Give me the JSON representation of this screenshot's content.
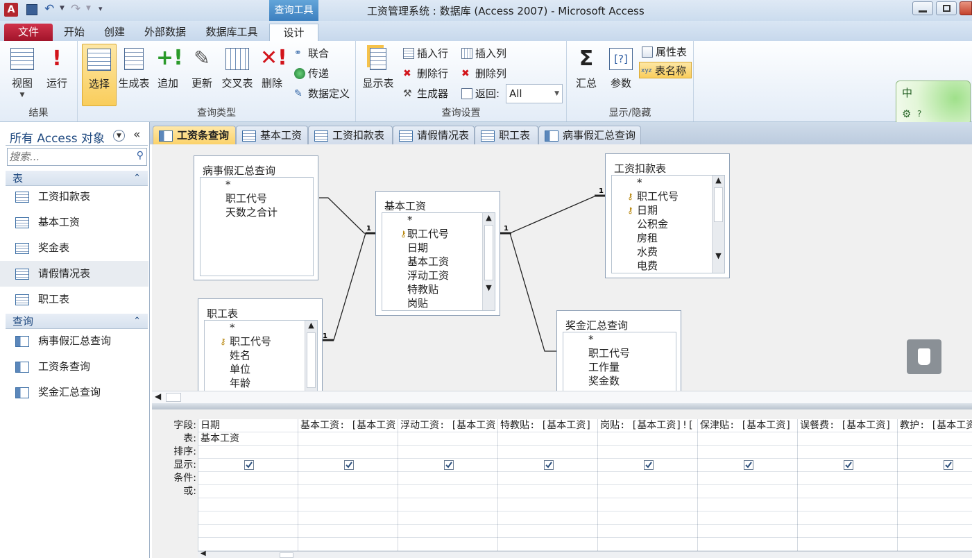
{
  "window": {
    "title": "工资管理系统 : 数据库 (Access 2007) - Microsoft Access",
    "context_tab": "查询工具"
  },
  "ribbon_tabs": [
    "文件",
    "开始",
    "创建",
    "外部数据",
    "数据库工具",
    "设计"
  ],
  "ribbon": {
    "results": {
      "label": "结果",
      "view": "视图",
      "run": "运行"
    },
    "query_type": {
      "label": "查询类型",
      "select": "选择",
      "make_table": "生成表",
      "append": "追加",
      "update": "更新",
      "crosstab": "交叉表",
      "delete": "删除",
      "union": "联合",
      "passthrough": "传递",
      "data_def": "数据定义"
    },
    "query_setup": {
      "label": "查询设置",
      "show_table": "显示表",
      "insert_row": "插入行",
      "delete_row": "删除行",
      "builder": "生成器",
      "insert_col": "插入列",
      "delete_col": "删除列",
      "return_label": "返回:",
      "return_value": "All"
    },
    "show_hide": {
      "label": "显示/隐藏",
      "totals": "汇总",
      "params": "参数",
      "property_sheet": "属性表",
      "table_names": "表名称"
    }
  },
  "lang_badge": "中",
  "nav": {
    "title": "所有 Access 对象",
    "search_placeholder": "搜索...",
    "tables_header": "表",
    "tables": [
      "工资扣款表",
      "基本工资",
      "奖金表",
      "请假情况表",
      "职工表"
    ],
    "queries_header": "查询",
    "queries": [
      "病事假汇总查询",
      "工资条查询",
      "奖金汇总查询"
    ]
  },
  "doc_tabs": [
    "工资条查询",
    "基本工资",
    "工资扣款表",
    "请假情况表",
    "职工表",
    "病事假汇总查询"
  ],
  "field_lists": [
    {
      "title": "病事假汇总查询",
      "fields": [
        "*",
        "职工代号",
        "天数之合计"
      ]
    },
    {
      "title": "基本工资",
      "fields": [
        "*",
        "职工代号",
        "日期",
        "基本工资",
        "浮动工资",
        "特教贴",
        "岗贴"
      ]
    },
    {
      "title": "工资扣款表",
      "fields": [
        "*",
        "职工代号",
        "日期",
        "公积金",
        "房租",
        "水费",
        "电费"
      ]
    },
    {
      "title": "职工表",
      "fields": [
        "*",
        "职工代号",
        "姓名",
        "单位",
        "年龄"
      ]
    },
    {
      "title": "奖金汇总查询",
      "fields": [
        "*",
        "职工代号",
        "工作量",
        "奖金数"
      ]
    }
  ],
  "join_marker": "1",
  "qbe": {
    "row_labels": [
      "字段:",
      "表:",
      "排序:",
      "显示:",
      "条件:",
      "或:"
    ],
    "columns": [
      {
        "field": "日期",
        "table": "基本工资"
      },
      {
        "field": "基本工资: [基本工资",
        "table": ""
      },
      {
        "field": "浮动工资: [基本工资",
        "table": ""
      },
      {
        "field": "特教贴: [基本工资]",
        "table": ""
      },
      {
        "field": "岗贴: [基本工资]![",
        "table": ""
      },
      {
        "field": "保津贴: [基本工资]",
        "table": ""
      },
      {
        "field": "误餐费: [基本工资]",
        "table": ""
      },
      {
        "field": "教护: [基本工资",
        "table": ""
      }
    ]
  }
}
